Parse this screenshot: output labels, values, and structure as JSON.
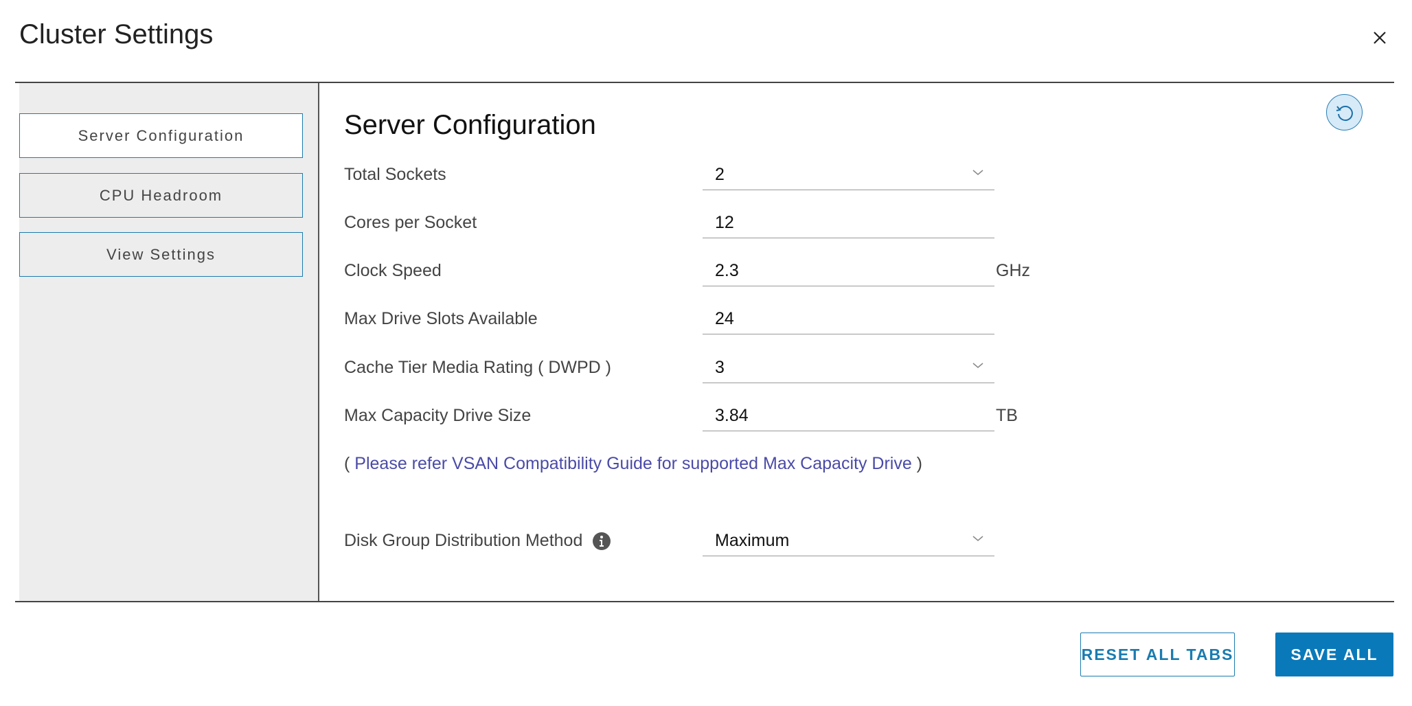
{
  "dialog": {
    "title": "Cluster Settings",
    "close_icon": "close-icon"
  },
  "sidebar": {
    "items": [
      {
        "label": "Server Configuration",
        "active": true
      },
      {
        "label": "CPU Headroom",
        "active": false
      },
      {
        "label": "View Settings",
        "active": false
      }
    ]
  },
  "main": {
    "heading": "Server Configuration",
    "refresh_icon": "refresh-icon",
    "fields": [
      {
        "label": "Total Sockets",
        "value": "2",
        "type": "select"
      },
      {
        "label": "Cores per Socket",
        "value": "12",
        "type": "input"
      },
      {
        "label": "Clock Speed",
        "value": "2.3",
        "unit": "GHz",
        "type": "input"
      },
      {
        "label": "Max Drive Slots Available",
        "value": "24",
        "type": "input"
      },
      {
        "label": "Cache Tier Media Rating ( DWPD )",
        "value": "3",
        "type": "select"
      },
      {
        "label": "Max Capacity Drive Size",
        "value": "3.84",
        "unit": "TB",
        "type": "input"
      }
    ],
    "note_open": "( ",
    "note_link": "Please refer VSAN Compatibility Guide for supported Max Capacity Drive",
    "note_close": " )",
    "distribution": {
      "label": "Disk Group Distribution Method",
      "value": "Maximum",
      "info_icon": "info-icon"
    }
  },
  "footer": {
    "reset_label": "RESET ALL TABS",
    "save_label": "SAVE ALL"
  },
  "colors": {
    "accent": "#0a79b9",
    "link": "#4a4aa8",
    "sidebar_bg": "#ededed"
  }
}
